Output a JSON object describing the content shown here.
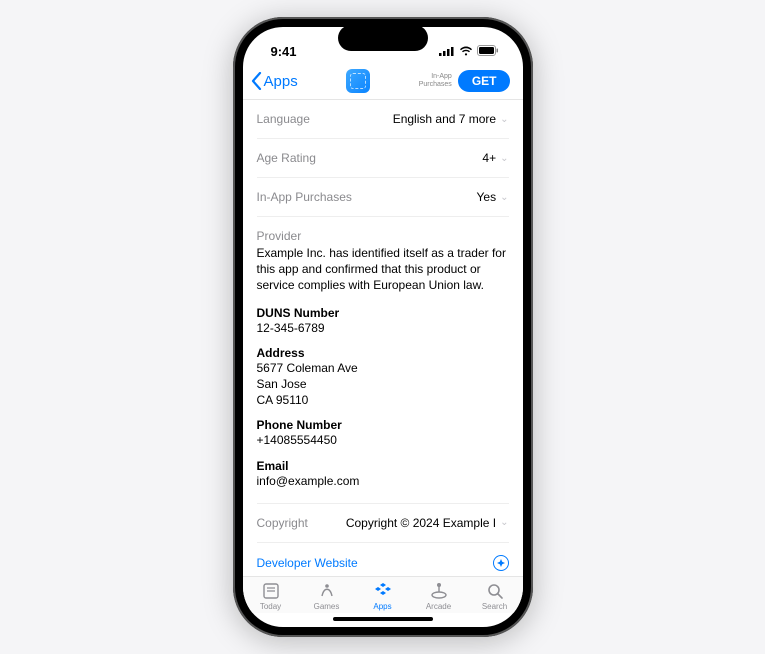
{
  "status": {
    "time": "9:41"
  },
  "nav": {
    "back_label": "Apps",
    "iap_hint": "In-App\nPurchases",
    "get_label": "GET"
  },
  "rows": {
    "language_label": "Language",
    "language_value": "English and 7 more",
    "age_label": "Age Rating",
    "age_value": "4+",
    "iap_label": "In-App Purchases",
    "iap_value": "Yes",
    "copyright_label": "Copyright",
    "copyright_value": "Copyright © 2024 Example I"
  },
  "provider": {
    "header": "Provider",
    "description": "Example Inc. has identified itself as a trader for this app and confirmed that this product or service complies with European Union law.",
    "duns_title": "DUNS Number",
    "duns_value": "12-345-6789",
    "address_title": "Address",
    "address_line1": "5677 Coleman Ave",
    "address_line2": "San Jose",
    "address_line3": "CA 95110",
    "phone_title": "Phone Number",
    "phone_value": "+14085554450",
    "email_title": "Email",
    "email_value": "info@example.com"
  },
  "dev_link": "Developer Website",
  "tabs": {
    "today": "Today",
    "games": "Games",
    "apps": "Apps",
    "arcade": "Arcade",
    "search": "Search"
  }
}
